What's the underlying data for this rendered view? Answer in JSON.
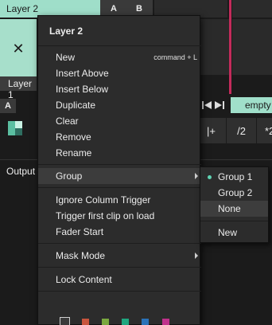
{
  "background": {
    "layer2_tab": "Layer 2",
    "a_label": "A",
    "b_label": "B",
    "close_glyph": "✕",
    "layer1_tab": "Layer 1",
    "a_button": "A",
    "empty_tab": "empty",
    "speed_buttons": [
      "|+",
      "/2",
      "*2"
    ],
    "output_label": "Output"
  },
  "menu": {
    "title": "Layer 2",
    "items": [
      {
        "label": "New",
        "shortcut": "command + L"
      },
      {
        "label": "Insert Above"
      },
      {
        "label": "Insert Below"
      },
      {
        "label": "Duplicate"
      },
      {
        "label": "Clear"
      },
      {
        "label": "Remove"
      },
      {
        "label": "Rename"
      },
      {
        "label": "Group",
        "submenu": true
      },
      {
        "label": "Ignore Column Trigger"
      },
      {
        "label": "Trigger first clip on load"
      },
      {
        "label": "Fader Start"
      },
      {
        "label": "Mask Mode",
        "submenu": true
      },
      {
        "label": "Lock Content"
      }
    ],
    "colors": [
      "#3a3a3a",
      "#c8553d",
      "#7aa83f",
      "#1fa67f",
      "#2a72b8",
      "#c0318c"
    ]
  },
  "submenu": {
    "items": [
      {
        "label": "Group 1",
        "selected": true
      },
      {
        "label": "Group 2"
      },
      {
        "label": "None"
      },
      {
        "label": "New"
      }
    ]
  },
  "colors": {
    "accent": "#9fdec9",
    "selected_dot": "#5fd4b3",
    "marker": "#c42b5b"
  }
}
